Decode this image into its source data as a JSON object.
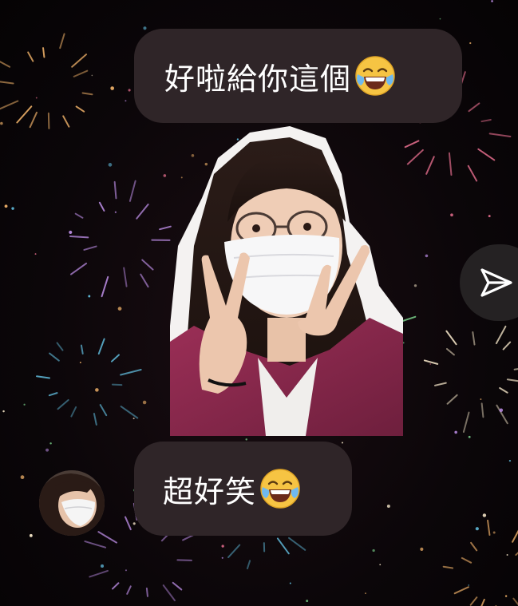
{
  "messages": [
    {
      "text": "好啦給你這個",
      "emoji": "face-with-tears-of-joy"
    },
    {
      "text": "超好笑",
      "emoji": "face-with-tears-of-joy"
    }
  ],
  "colors": {
    "bubble_bg": "#2f2528",
    "bubble_text": "#ffffff",
    "background": "#0a0508",
    "send_button_bg": "#252223",
    "firework_gold": "#f2b36a",
    "firework_violet": "#b88ae0"
  },
  "icons": {
    "send": "paper-plane-icon",
    "emoji": "laughing-emoji-icon"
  }
}
